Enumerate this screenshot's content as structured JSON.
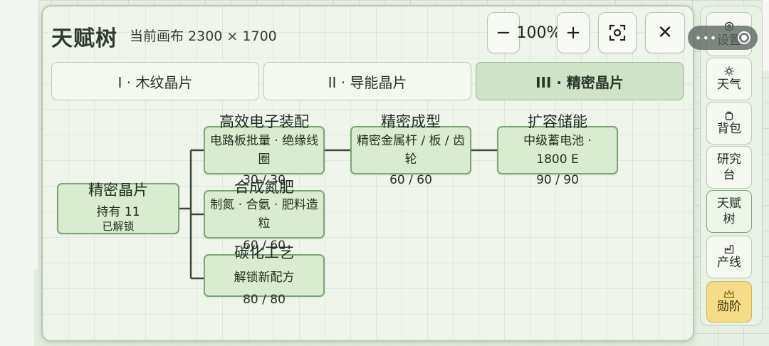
{
  "panel": {
    "title": "天赋树",
    "canvas_info": "当前画布 2300 × 1700",
    "zoom_level": "100%",
    "buttons": {
      "zoom_out": "−",
      "zoom_in": "+",
      "fit": "⊡",
      "close": "✕"
    }
  },
  "tabs": [
    {
      "label": "I · 木纹晶片",
      "active": false
    },
    {
      "label": "II · 导能晶片",
      "active": false
    },
    {
      "label": "III · 精密晶片",
      "active": true
    }
  ],
  "tree": {
    "root": {
      "title": "精密晶片",
      "held": "持有 11",
      "status": "已解锁"
    },
    "nodes": [
      {
        "title": "高效电子装配",
        "desc": "电路板批量 · 绝缘线圈",
        "progress": "30 / 30"
      },
      {
        "title": "合成氮肥",
        "desc": "制氮 · 合氨 · 肥料造粒",
        "progress": "60 / 60"
      },
      {
        "title": "碳化工艺",
        "desc": "解锁新配方",
        "progress": "80 / 80"
      },
      {
        "title": "精密成型",
        "desc": "精密金属杆 / 板 / 齿轮",
        "progress": "60 / 60"
      },
      {
        "title": "扩容储能",
        "desc": "中级蓄电池 · 1800 E",
        "progress": "90 / 90"
      }
    ]
  },
  "sidebar": [
    {
      "label": "设置",
      "icon": "settings-icon"
    },
    {
      "label": "天气",
      "icon": "sun-icon"
    },
    {
      "label": "背包",
      "icon": "backpack-icon"
    },
    {
      "label": "研究台",
      "icon": ""
    },
    {
      "label": "天赋树",
      "icon": "",
      "active": true
    },
    {
      "label": "产线",
      "icon": "factory-icon"
    },
    {
      "label": "勋阶",
      "icon": "crown-icon",
      "highlight": true
    }
  ],
  "colors": {
    "accent": "#cfe3c8",
    "node_fill": "#d9eccf",
    "node_border": "#7fa47a",
    "medal_gold": "#f5dc86"
  }
}
